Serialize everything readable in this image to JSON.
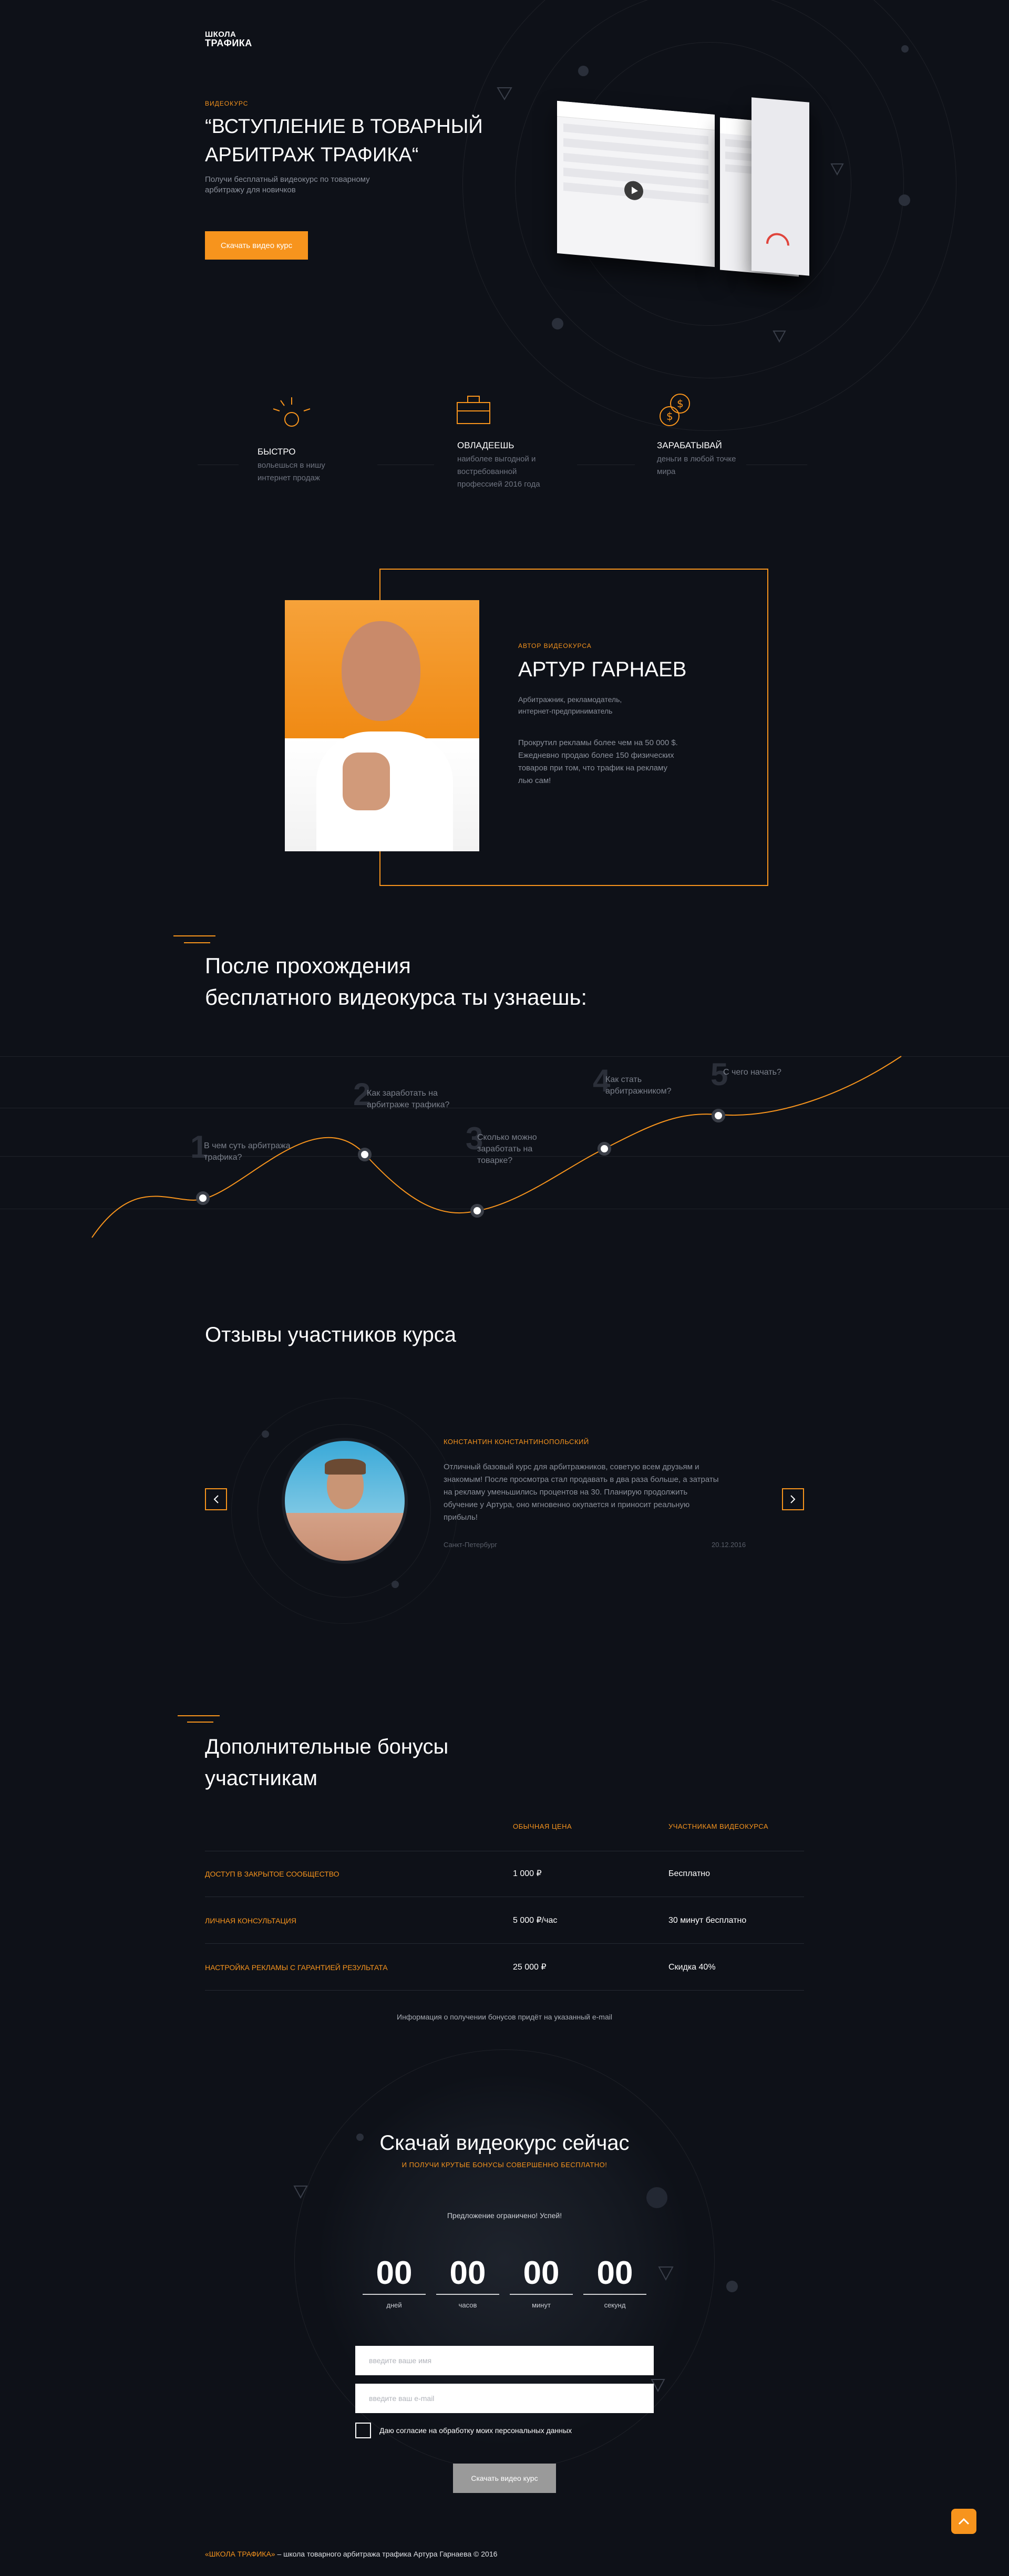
{
  "brand": {
    "logo_line1": "ШКОЛА",
    "logo_line2": "ТРАФИКА"
  },
  "hero": {
    "eyebrow": "ВИДЕОКУРС",
    "title_line1": "“ВСТУПЛЕНИЕ В ТОВАРНЫЙ",
    "title_line2": "АРБИТРАЖ ТРАФИКА“",
    "subtitle_line1": "Получи бесплатный видеокурс по товарному",
    "subtitle_line2": "арбитражу для новичков",
    "cta_label": "Скачать видео курс"
  },
  "features": [
    {
      "title": "БЫСТРО",
      "line1": "вольешься в нишу",
      "line2": "интернет продаж",
      "line3": "",
      "icon": "bomb-icon"
    },
    {
      "title": "ОВЛАДЕЕШЬ",
      "line1": "наиболее выгодной и",
      "line2": "востребованной",
      "line3": "профессией 2016 года",
      "icon": "briefcase-icon"
    },
    {
      "title": "ЗАРАБАТЫВАЙ",
      "line1": "деньги в любой точке",
      "line2": "мира",
      "line3": "",
      "icon": "coins-icon"
    }
  ],
  "author": {
    "eyebrow": "АВТОР ВИДЕОКУРСА",
    "name": "АРТУР ГАРНАЕВ",
    "role_line1": "Арбитражник, рекламодатель,",
    "role_line2": "интернет-предприниматель",
    "bio_line1": "Прокрутил рекламы более чем на 50 000 $.",
    "bio_line2": "Ежедневно продаю более 150 физических",
    "bio_line3": "товаров при том, что трафик на рекламу",
    "bio_line4": "лью сам!"
  },
  "learn": {
    "heading_line1": "После прохождения",
    "heading_line2": "бесплатного видеокурса ты узнаешь:",
    "steps": [
      {
        "num": "1",
        "line1": "В чем суть арбитража",
        "line2": "трафика?"
      },
      {
        "num": "2",
        "line1": "Как заработать на",
        "line2": "арбитраже трафика?"
      },
      {
        "num": "3",
        "line1": "Сколько можно",
        "line2": "заработать на",
        "line3": "товарке?"
      },
      {
        "num": "4",
        "line1": "Как стать",
        "line2": "арбитражником?"
      },
      {
        "num": "5",
        "line1": "С чего начать?",
        "line2": ""
      }
    ]
  },
  "reviews": {
    "heading": "Отзывы участников курса",
    "name": "КОНСТАНТИН КОНСТАНТИНОПОЛЬСКИЙ",
    "text_line1": "Отличный базовый курс для арбитражников, советую всем друзьям и",
    "text_line2": "знакомым! После просмотра стал продавать в два раза больше, а затраты",
    "text_line3": "на рекламу уменьшились процентов на 30. Планирую продолжить",
    "text_line4": "обучение у Артура, оно мгновенно окупается и приносит реальную",
    "text_line5": "прибыль!",
    "city": "Санкт-Петербург",
    "date": "20.12.2016"
  },
  "bonuses": {
    "heading_line1": "Дополнительные бонусы",
    "heading_line2": "участникам",
    "col_regular": "ОБЫЧНАЯ ЦЕНА",
    "col_members": "УЧАСТНИКАМ ВИДЕОКУРСА",
    "rows": [
      {
        "name": "ДОСТУП В ЗАКРЫТОЕ СООБЩЕСТВО",
        "regular": "1 000 ₽",
        "members": "Бесплатно"
      },
      {
        "name": "ЛИЧНАЯ КОНСУЛЬТАЦИЯ",
        "regular": "5 000 ₽/час",
        "members": "30 минут бесплатно"
      },
      {
        "name": "НАСТРОЙКА РЕКЛАМЫ С ГАРАНТИЕЙ РЕЗУЛЬТАТА",
        "regular": "25 000 ₽",
        "members": "Скидка 40%"
      }
    ],
    "note": "Информация о получении бонусов придёт на указанный e-mail"
  },
  "download": {
    "heading": "Скачай видеокурс сейчас",
    "sub": "И ПОЛУЧИ КРУТЫЕ БОНУСЫ СОВЕРШЕННО БЕСПЛАТНО!",
    "limited": "Предложение ограничено! Успей!",
    "countdown": [
      {
        "value": "00",
        "label": "дней"
      },
      {
        "value": "00",
        "label": "часов"
      },
      {
        "value": "00",
        "label": "минут"
      },
      {
        "value": "00",
        "label": "секунд"
      }
    ],
    "name_placeholder": "введите ваше имя",
    "email_placeholder": "введите ваш e-mail",
    "consent": "Даю согласие на обработку моих персональных данных",
    "submit_label": "Скачать видео курс"
  },
  "footer": {
    "brand": "«ШКОЛА ТРАФИКА»",
    "text": " – школа товарного арбитража трафика Артура Гарнаева © 2016"
  },
  "colors": {
    "accent": "#f7941d",
    "bg": "#0e1118",
    "muted": "#8a8f9a"
  }
}
